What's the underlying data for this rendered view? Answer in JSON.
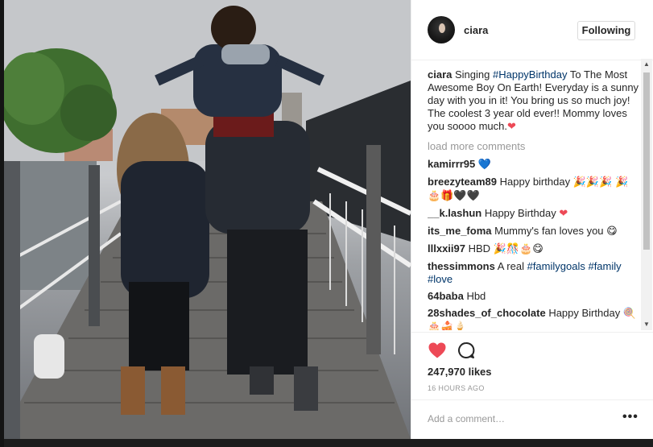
{
  "post": {
    "username": "ciara",
    "follow_label": "Following",
    "caption_user": "ciara",
    "caption_pre": "Singing ",
    "caption_tag": "#HappyBirthday",
    "caption_post": " To The Most Awesome Boy On Earth! Everyday is a sunny day with you in it! You bring us so much joy! The coolest 3 year old ever!! Mommy loves you soooo much.",
    "caption_emoji": "❤",
    "load_more": "load more comments"
  },
  "comments": [
    {
      "user": "kamirrr95",
      "text": "",
      "emoji": "💙"
    },
    {
      "user": "breezyteam89",
      "text": "Happy birthday",
      "emoji": "🎉🎉🎉 🎉🎂🎁🖤🖤"
    },
    {
      "user": "__k.lashun",
      "text": "Happy Birthday",
      "emoji": "❤"
    },
    {
      "user": "its_me_foma",
      "text": "Mummy's fan loves you",
      "emoji": "😋"
    },
    {
      "user": "lllxxii97",
      "text": "HBD",
      "emoji": "🎉🎊🎂😋"
    },
    {
      "user": "thessimmons",
      "text": "A real",
      "tags": "#familygoals #family #love",
      "emoji": ""
    },
    {
      "user": "64baba",
      "text": "Hbd",
      "emoji": ""
    },
    {
      "user": "28shades_of_chocolate",
      "text": "Happy Birthday",
      "emoji": "🍭 🎂🍰🍦"
    }
  ],
  "footer": {
    "likes": "247,970 likes",
    "time": "16 HOURS AGO",
    "comment_placeholder": "Add a comment…",
    "more": "•••"
  },
  "icons": {
    "like": "heart-icon",
    "comment": "comment-bubble-icon",
    "scroll_up": "scroll-up-arrow-icon",
    "scroll_down": "scroll-down-arrow-icon"
  },
  "colors": {
    "like_red": "#ed4956",
    "hashtag_blue": "#003569",
    "muted_gray": "#999999"
  }
}
